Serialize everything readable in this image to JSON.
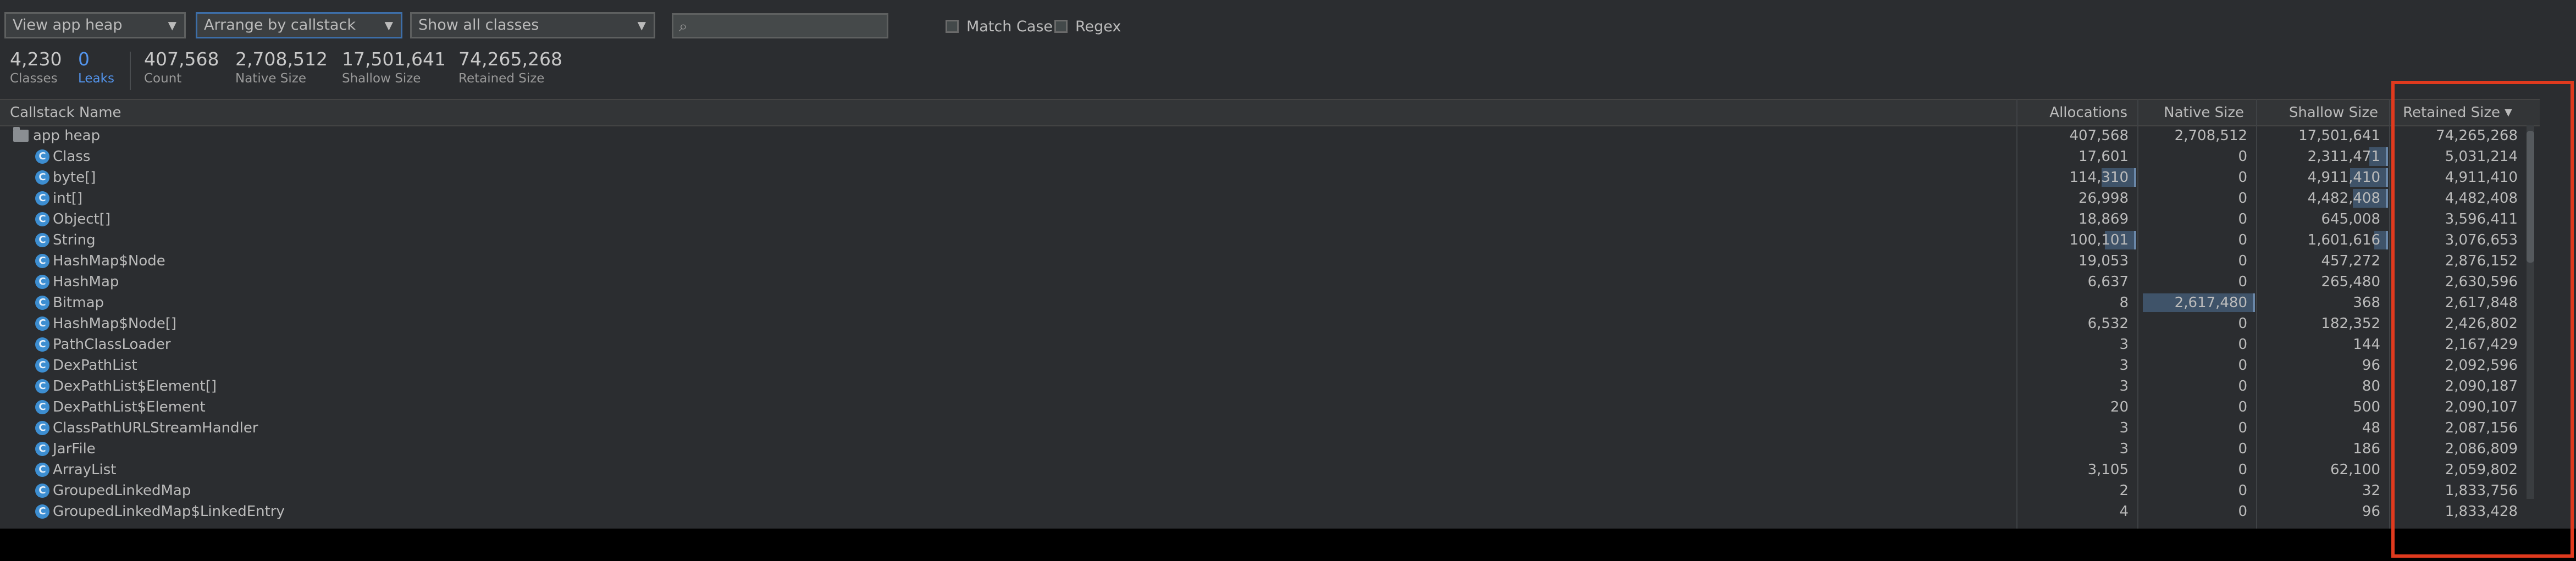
{
  "toolbar": {
    "heap_select": "View app heap",
    "arrange_select": "Arrange by callstack",
    "filter_select": "Show all classes",
    "search_placeholder": "",
    "match_case_label": "Match Case",
    "regex_label": "Regex"
  },
  "stats": [
    {
      "value": "4,230",
      "label": "Classes"
    },
    {
      "value": "0",
      "label": "Leaks"
    },
    {
      "value": "407,568",
      "label": "Count"
    },
    {
      "value": "2,708,512",
      "label": "Native Size"
    },
    {
      "value": "17,501,641",
      "label": "Shallow Size"
    },
    {
      "value": "74,265,268",
      "label": "Retained Size"
    }
  ],
  "columns": {
    "name": "Callstack Name",
    "allocations": "Allocations",
    "native": "Native Size",
    "shallow": "Shallow Size",
    "retained": "Retained Size",
    "sort_indicator": "▼"
  },
  "root_row": {
    "name": "app heap",
    "allocations": "407,568",
    "native": "2,708,512",
    "shallow": "17,501,641",
    "retained": "74,265,268"
  },
  "icon_letter": "C",
  "rows": [
    {
      "name": "Class",
      "allocations": "17,601",
      "native": "0",
      "shallow": "2,311,471",
      "retained": "5,031,214",
      "alloc_frac": 0.0,
      "native_frac": 0.0,
      "shallow_frac": 0.13
    },
    {
      "name": "byte[]",
      "allocations": "114,310",
      "native": "0",
      "shallow": "4,911,410",
      "retained": "4,911,410",
      "alloc_frac": 0.28,
      "native_frac": 0.0,
      "shallow_frac": 0.28
    },
    {
      "name": "int[]",
      "allocations": "26,998",
      "native": "0",
      "shallow": "4,482,408",
      "retained": "4,482,408",
      "alloc_frac": 0.0,
      "native_frac": 0.0,
      "shallow_frac": 0.26
    },
    {
      "name": "Object[]",
      "allocations": "18,869",
      "native": "0",
      "shallow": "645,008",
      "retained": "3,596,411",
      "alloc_frac": 0.0,
      "native_frac": 0.0,
      "shallow_frac": 0.0
    },
    {
      "name": "String",
      "allocations": "100,101",
      "native": "0",
      "shallow": "1,601,616",
      "retained": "3,076,653",
      "alloc_frac": 0.25,
      "native_frac": 0.0,
      "shallow_frac": 0.09
    },
    {
      "name": "HashMap$Node",
      "allocations": "19,053",
      "native": "0",
      "shallow": "457,272",
      "retained": "2,876,152",
      "alloc_frac": 0.0,
      "native_frac": 0.0,
      "shallow_frac": 0.0
    },
    {
      "name": "HashMap",
      "allocations": "6,637",
      "native": "0",
      "shallow": "265,480",
      "retained": "2,630,596",
      "alloc_frac": 0.0,
      "native_frac": 0.0,
      "shallow_frac": 0.0
    },
    {
      "name": "Bitmap",
      "allocations": "8",
      "native": "2,617,480",
      "shallow": "368",
      "retained": "2,617,848",
      "alloc_frac": 0.0,
      "native_frac": 0.97,
      "shallow_frac": 0.0
    },
    {
      "name": "HashMap$Node[]",
      "allocations": "6,532",
      "native": "0",
      "shallow": "182,352",
      "retained": "2,426,802",
      "alloc_frac": 0.0,
      "native_frac": 0.0,
      "shallow_frac": 0.0
    },
    {
      "name": "PathClassLoader",
      "allocations": "3",
      "native": "0",
      "shallow": "144",
      "retained": "2,167,429",
      "alloc_frac": 0.0,
      "native_frac": 0.0,
      "shallow_frac": 0.0
    },
    {
      "name": "DexPathList",
      "allocations": "3",
      "native": "0",
      "shallow": "96",
      "retained": "2,092,596",
      "alloc_frac": 0.0,
      "native_frac": 0.0,
      "shallow_frac": 0.0
    },
    {
      "name": "DexPathList$Element[]",
      "allocations": "3",
      "native": "0",
      "shallow": "80",
      "retained": "2,090,187",
      "alloc_frac": 0.0,
      "native_frac": 0.0,
      "shallow_frac": 0.0
    },
    {
      "name": "DexPathList$Element",
      "allocations": "20",
      "native": "0",
      "shallow": "500",
      "retained": "2,090,107",
      "alloc_frac": 0.0,
      "native_frac": 0.0,
      "shallow_frac": 0.0
    },
    {
      "name": "ClassPathURLStreamHandler",
      "allocations": "3",
      "native": "0",
      "shallow": "48",
      "retained": "2,087,156",
      "alloc_frac": 0.0,
      "native_frac": 0.0,
      "shallow_frac": 0.0
    },
    {
      "name": "JarFile",
      "allocations": "3",
      "native": "0",
      "shallow": "186",
      "retained": "2,086,809",
      "alloc_frac": 0.0,
      "native_frac": 0.0,
      "shallow_frac": 0.0
    },
    {
      "name": "ArrayList",
      "allocations": "3,105",
      "native": "0",
      "shallow": "62,100",
      "retained": "2,059,802",
      "alloc_frac": 0.0,
      "native_frac": 0.0,
      "shallow_frac": 0.0
    },
    {
      "name": "GroupedLinkedMap",
      "allocations": "2",
      "native": "0",
      "shallow": "32",
      "retained": "1,833,756",
      "alloc_frac": 0.0,
      "native_frac": 0.0,
      "shallow_frac": 0.0
    },
    {
      "name": "GroupedLinkedMap$LinkedEntry",
      "allocations": "4",
      "native": "0",
      "shallow": "96",
      "retained": "1,833,428",
      "alloc_frac": 0.0,
      "native_frac": 0.0,
      "shallow_frac": 0.0
    }
  ],
  "colors": {
    "background": "#2b2d30",
    "accent_link": "#5394ec",
    "highlight": "#e03a1e",
    "class_icon": "#3d8ed1",
    "bar": "#3f5369"
  }
}
